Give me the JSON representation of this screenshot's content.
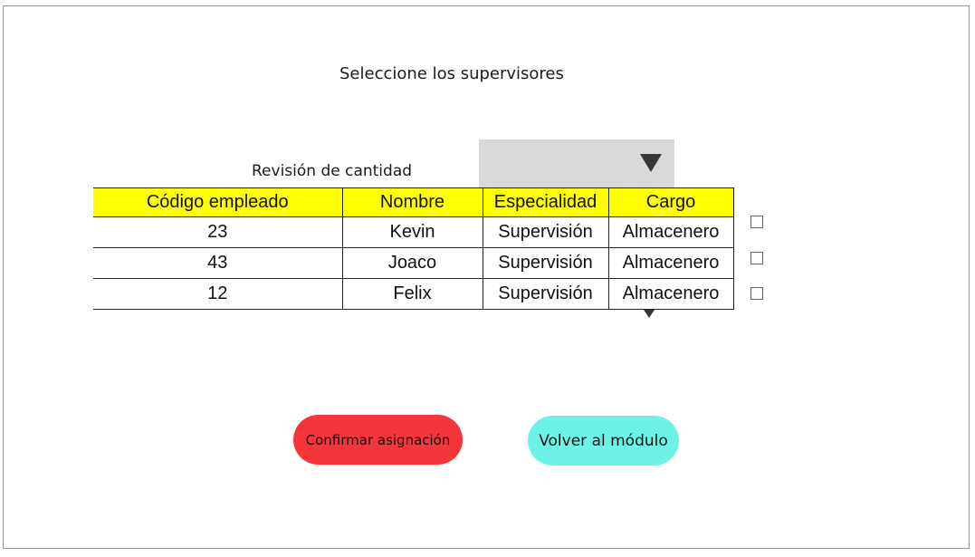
{
  "page": {
    "title": "Seleccione los supervisores"
  },
  "revision": {
    "label": "Revisión de cantidad",
    "dropdown_value": ""
  },
  "table": {
    "headers": [
      "Código empleado",
      "Nombre",
      "Especialidad",
      "Cargo"
    ],
    "rows": [
      {
        "code": "23",
        "name": "Kevin",
        "specialty": "Supervisión",
        "role": "Almacenero",
        "checked": false
      },
      {
        "code": "43",
        "name": "Joaco",
        "specialty": "Supervisión",
        "role": "Almacenero",
        "checked": false
      },
      {
        "code": "12",
        "name": "Felix",
        "specialty": "Supervisión",
        "role": "Almacenero",
        "checked": false
      }
    ]
  },
  "actions": {
    "confirm_label": "Confirmar asignación",
    "back_label": "Volver al módulo"
  },
  "colors": {
    "header_fill": "#ffff00",
    "dropdown_fill": "#d9d9d9",
    "confirm_button": "#f4363a",
    "back_button": "#6df2e6"
  },
  "icons": {
    "dropdown": "caret-down-icon",
    "table_caret": "caret-down-icon"
  }
}
